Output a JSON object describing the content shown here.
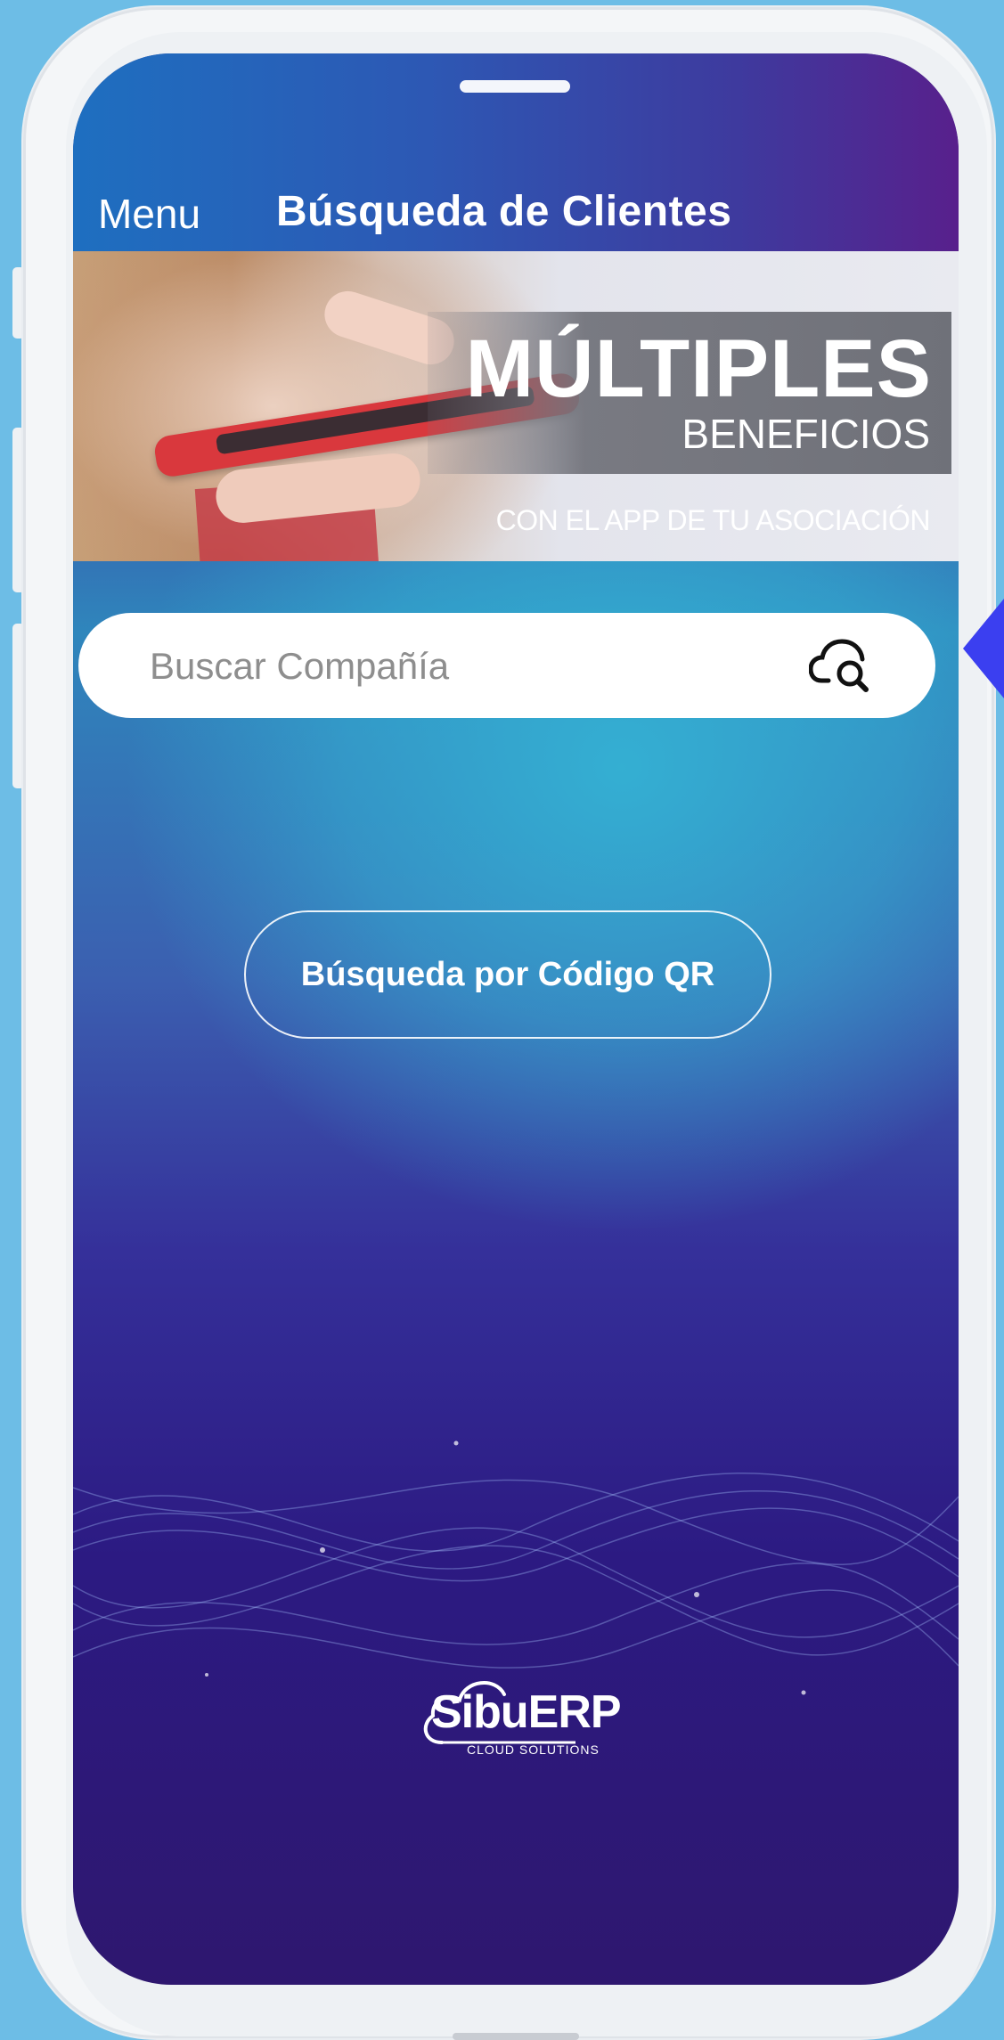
{
  "header": {
    "menu_label": "Menu",
    "title": "Búsqueda de Clientes"
  },
  "banner": {
    "title": "MÚLTIPLES",
    "subtitle": "BENEFICIOS",
    "tagline": "CON EL APP DE TU ASOCIACIÓN"
  },
  "search": {
    "placeholder": "Buscar Compañía",
    "value": "",
    "icon": "cloud-search-icon"
  },
  "qr_button": {
    "label": "Búsqueda por Código QR"
  },
  "logo": {
    "name": "SibuERP",
    "tagline": "CLOUD SOLUTIONS"
  },
  "colors": {
    "header_start": "#1e6fc0",
    "header_end": "#58208c",
    "background_top": "#3a4ea8",
    "background_mid": "#34b2d4",
    "background_bottom": "#2e176f",
    "device_backdrop": "#6dbde6"
  }
}
